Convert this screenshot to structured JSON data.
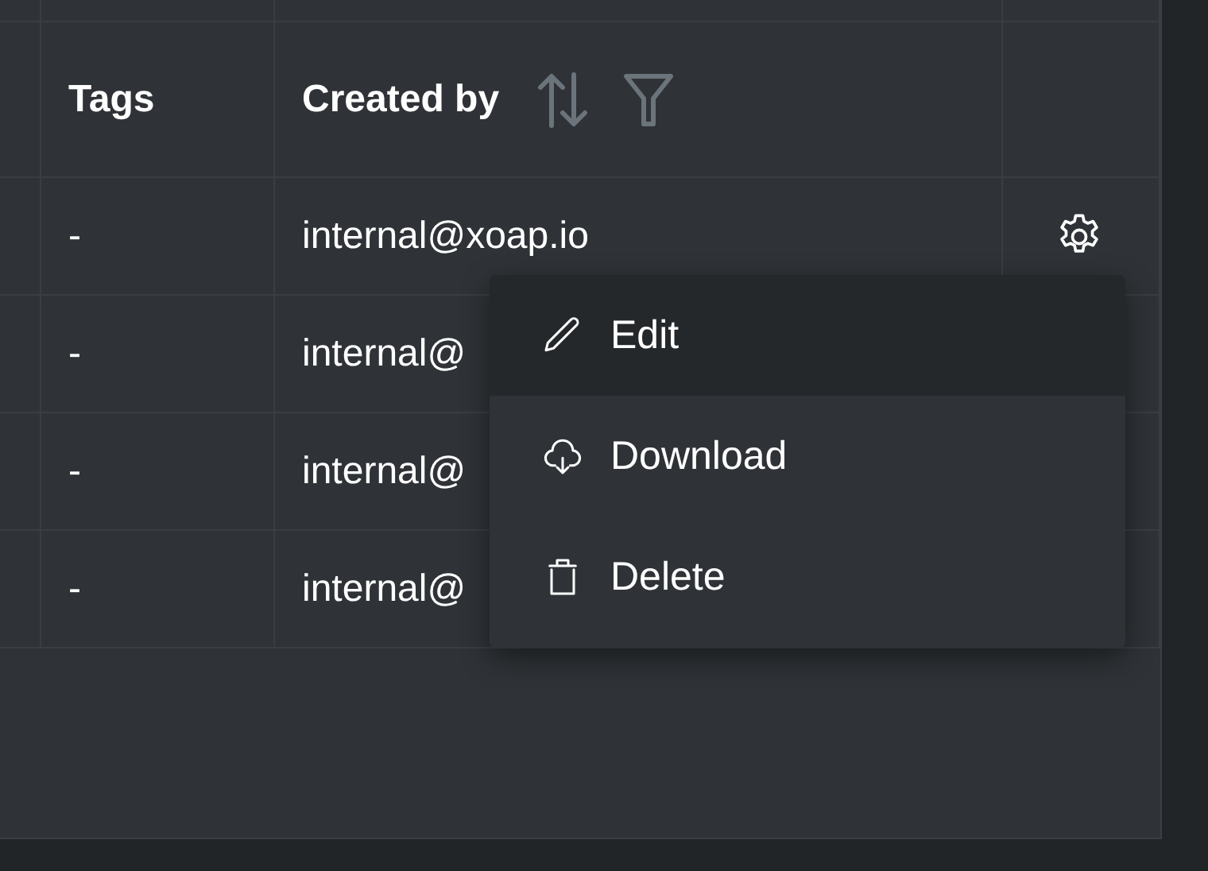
{
  "table": {
    "columns": [
      {
        "label": "Tags"
      },
      {
        "label": "Created by",
        "sortable": true,
        "filterable": true
      }
    ],
    "rows": [
      {
        "tags": "-",
        "created_by": "internal@xoap.io",
        "settings": true
      },
      {
        "tags": "-",
        "created_by": "internal@"
      },
      {
        "tags": "-",
        "created_by": "internal@"
      },
      {
        "tags": "-",
        "created_by": "internal@"
      }
    ]
  },
  "menu": {
    "items": [
      {
        "kind": "edit",
        "label": "Edit",
        "selected": true
      },
      {
        "kind": "download",
        "label": "Download",
        "selected": false
      },
      {
        "kind": "delete",
        "label": "Delete",
        "selected": false
      }
    ]
  }
}
